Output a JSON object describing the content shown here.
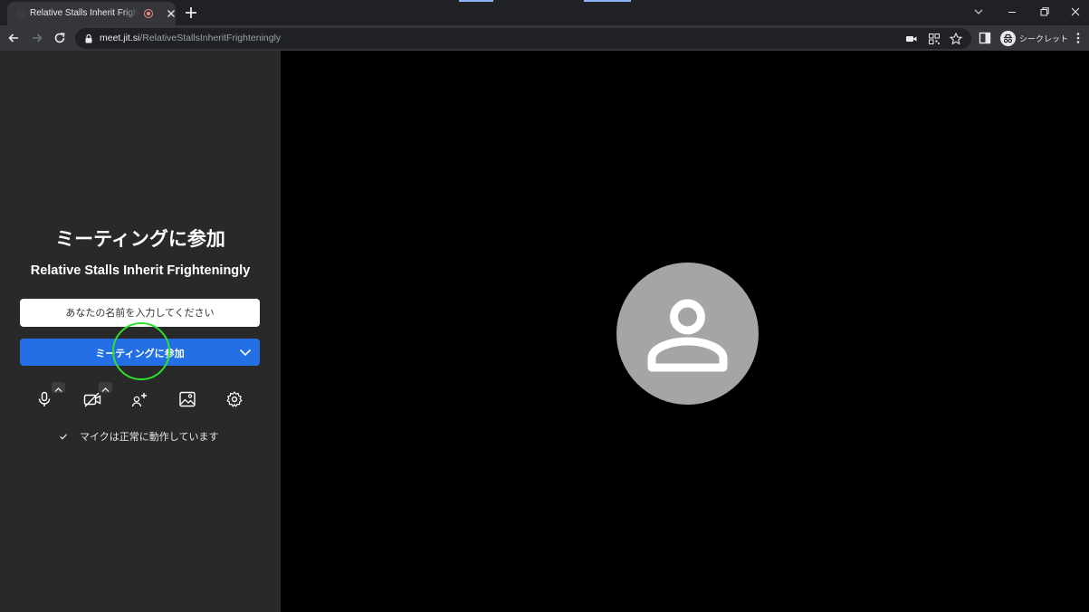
{
  "browser": {
    "tab": {
      "title": "Relative Stalls Inherit Frighteningly"
    },
    "address": {
      "host": "meet.jit.si",
      "path": "/RelativeStallsInheritFrighteningly"
    },
    "profile_label": "シークレット"
  },
  "prejoin": {
    "heading": "ミーティングに参加",
    "meeting_name": "Relative Stalls Inherit Frighteningly",
    "name_placeholder": "あなたの名前を入力してください",
    "join_label": "ミーティングに参加",
    "status_text": "マイクは正常に動作しています",
    "status_icon": "check-icon",
    "controls": [
      "microphone-icon",
      "camera-off-icon",
      "invite-icon",
      "background-icon",
      "settings-icon"
    ]
  },
  "colors": {
    "accent": "#246fe5",
    "panel": "#292929",
    "avatar": "#a5a5a5",
    "cursor_ring": "#2ee02e"
  }
}
